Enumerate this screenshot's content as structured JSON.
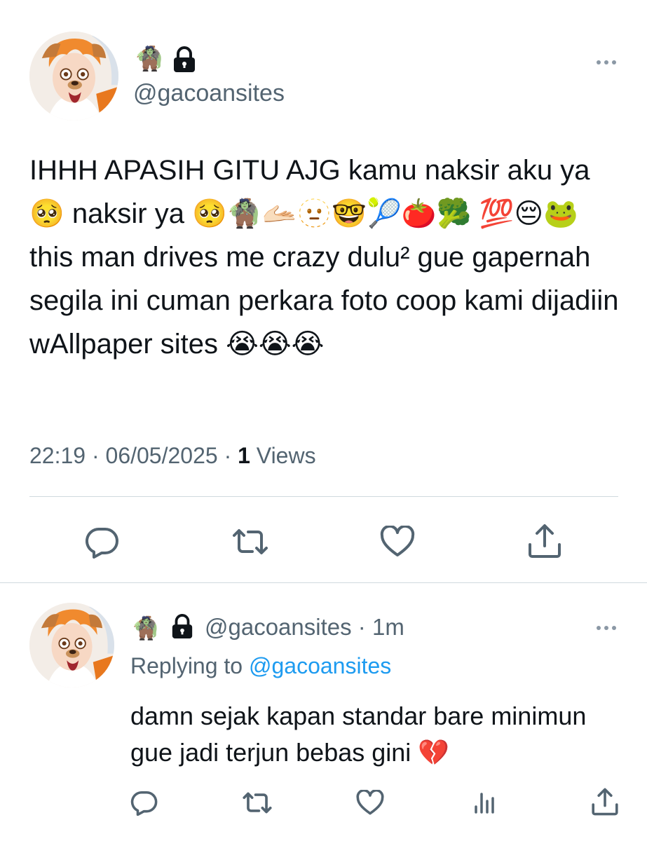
{
  "main_tweet": {
    "name_emoji": "🧌",
    "handle": "@gacoansites",
    "text": "IHHH APASIH GITU AJG kamu naksir aku ya 🥺 naksir ya 🥺🧌🫴🏻🫥🤓🎾🍅🥦 💯😔🐸 this man drives me crazy dulu² gue gapernah segila ini cuman perkara foto coop kami dijadiin wAllpaper sites 😭😭😭",
    "time": "22:19",
    "date": "06/05/2025",
    "views_count": "1",
    "views_label": "Views",
    "separator": "·",
    "icons": {
      "lock": "lock-icon",
      "more": "more-icon",
      "actions": [
        "reply-icon",
        "retweet-icon",
        "like-icon",
        "share-icon"
      ]
    }
  },
  "reply_tweet": {
    "name_emoji": "🧌",
    "handle": "@gacoansites",
    "time_ago": "1m",
    "separator": "·",
    "replying_label": "Replying to",
    "replying_handle": "@gacoansites",
    "text": "damn sejak kapan standar bare minimun gue jadi terjun bebas gini 💔",
    "icons": {
      "lock": "lock-icon",
      "more": "more-icon",
      "actions": [
        "reply-icon",
        "retweet-icon",
        "like-icon",
        "views-icon",
        "share-icon"
      ]
    }
  },
  "colors": {
    "text": "#0f1419",
    "secondary": "#536471",
    "link": "#1d9bf0",
    "divider": "#cfd9de",
    "icon": "#536471"
  }
}
